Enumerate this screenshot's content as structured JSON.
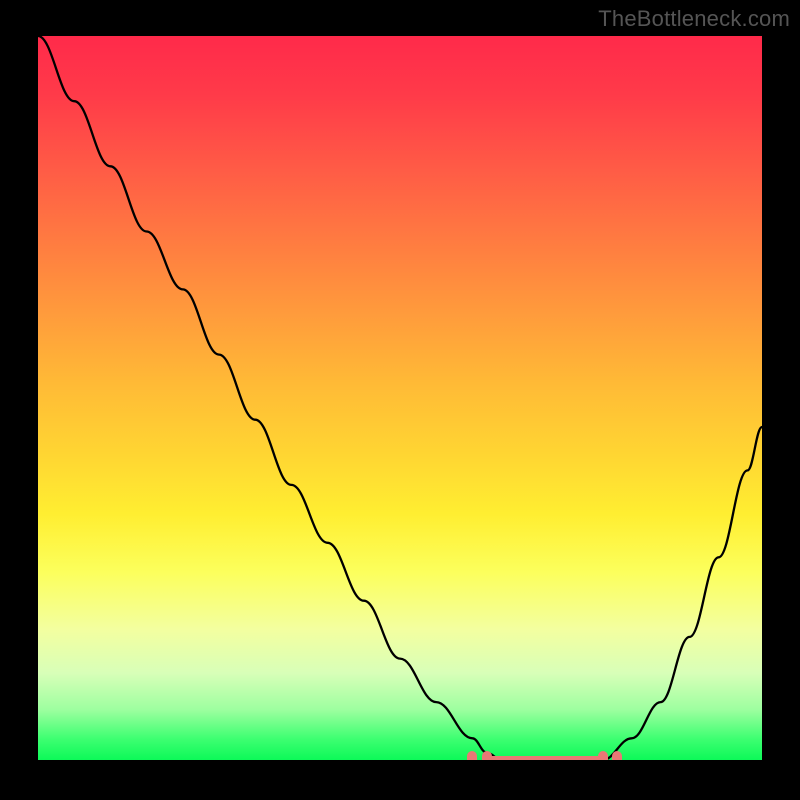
{
  "watermark": "TheBottleneck.com",
  "chart_data": {
    "type": "line",
    "x": [
      0,
      5,
      10,
      15,
      20,
      25,
      30,
      35,
      40,
      45,
      50,
      55,
      60,
      62,
      64,
      66,
      70,
      74,
      78,
      82,
      86,
      90,
      94,
      98,
      100
    ],
    "values": [
      100,
      91,
      82,
      73,
      65,
      56,
      47,
      38,
      30,
      22,
      14,
      8,
      3,
      1,
      0,
      0,
      0,
      0,
      0,
      3,
      8,
      17,
      28,
      40,
      46
    ],
    "title": "",
    "xlabel": "",
    "ylabel": "",
    "xlim": [
      0,
      100
    ],
    "ylim": [
      0,
      100
    ],
    "annotations": {
      "flat_bottom_range_x": [
        62,
        78
      ],
      "markers_x": [
        60,
        62,
        78,
        80
      ]
    }
  },
  "colors": {
    "curve": "#000000",
    "markers": "#e97875"
  }
}
